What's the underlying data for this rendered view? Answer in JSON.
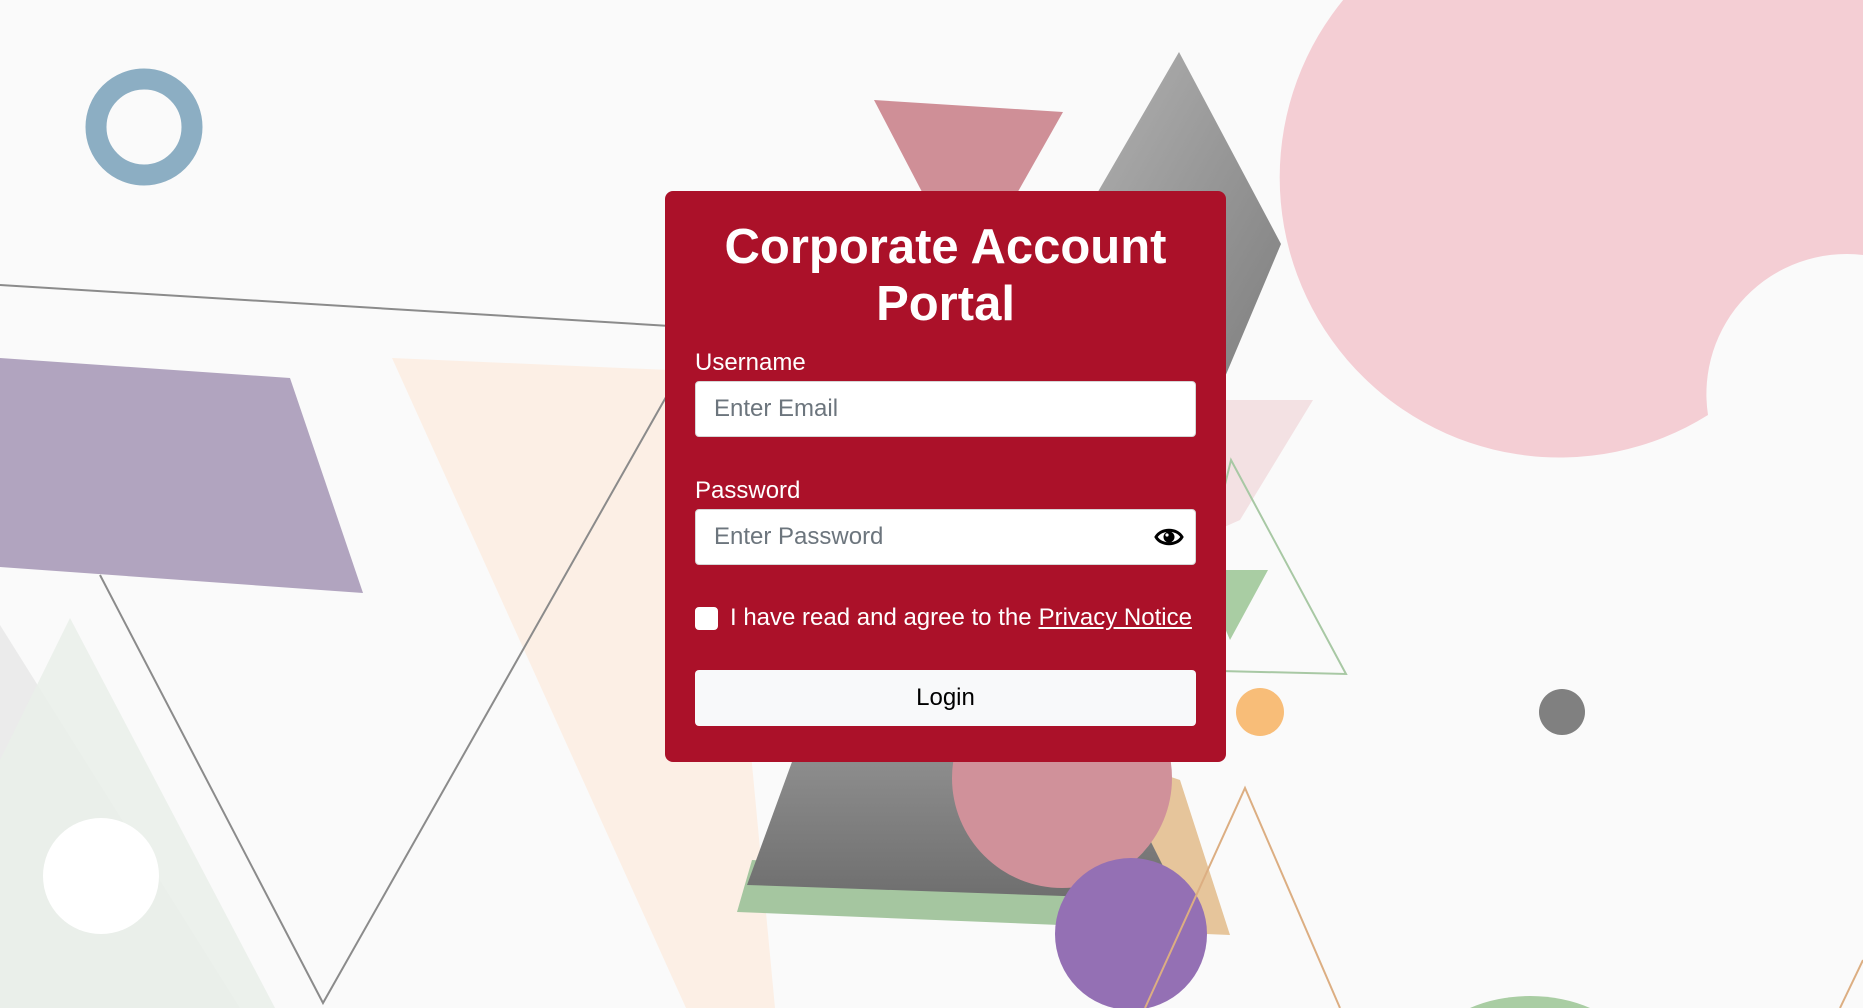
{
  "login_form": {
    "title": "Corporate Account Portal",
    "username_label": "Username",
    "username_placeholder": "Enter Email",
    "username_value": "",
    "password_label": "Password",
    "password_placeholder": "Enter Password",
    "password_value": "",
    "password_toggle_icon": "eye-icon",
    "agree_text": "I have read and agree to the",
    "agree_link": "Privacy Notice",
    "agree_checked": false,
    "login_label": "Login"
  },
  "colors": {
    "card": "#ab1129",
    "page_background": "#fafafa",
    "button": "#f8f9fa"
  }
}
